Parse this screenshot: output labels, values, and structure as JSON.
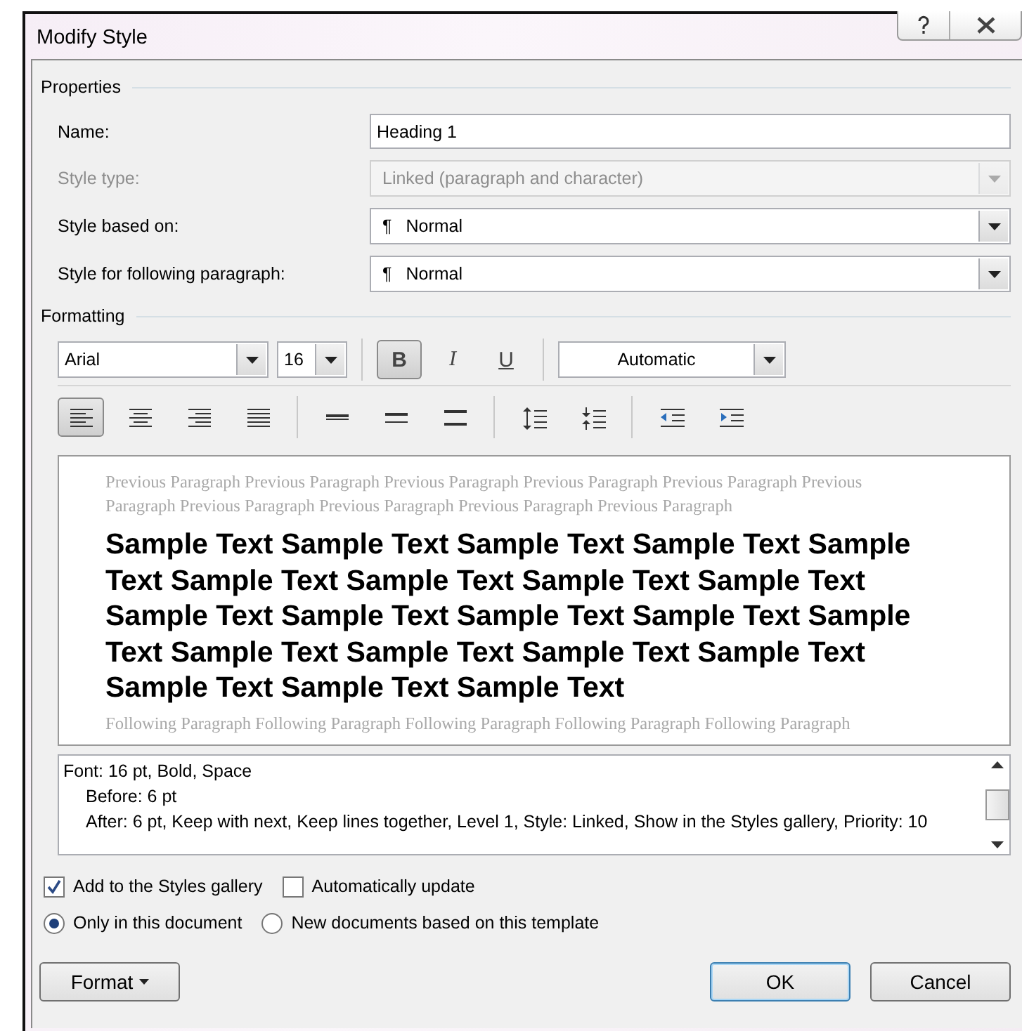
{
  "window": {
    "title": "Modify Style"
  },
  "properties": {
    "heading": "Properties",
    "fields": [
      {
        "label": "Name:",
        "kind": "text",
        "value": "Heading 1",
        "disabled": false
      },
      {
        "label": "Style type:",
        "kind": "combo",
        "value": "Linked (paragraph and character)",
        "disabled": true
      },
      {
        "label": "Style based on:",
        "kind": "combo",
        "symbol": "¶",
        "value": "Normal",
        "disabled": false
      },
      {
        "label": "Style for following paragraph:",
        "kind": "combo",
        "symbol": "¶",
        "value": "Normal",
        "disabled": false
      }
    ]
  },
  "formatting": {
    "heading": "Formatting",
    "font": "Arial",
    "size": "16",
    "color_setting": "Automatic",
    "style_buttons": [
      {
        "label": "B",
        "kind": "bold",
        "on": true
      },
      {
        "label": "I",
        "kind": "italic",
        "on": false
      },
      {
        "label": "U",
        "kind": "underline",
        "on": false
      }
    ],
    "paragraph_groups": [
      [
        {
          "kind": "align-left",
          "selected": true
        },
        {
          "kind": "align-center",
          "selected": false
        },
        {
          "kind": "align-right",
          "selected": false
        },
        {
          "kind": "justify",
          "selected": false
        }
      ],
      [
        {
          "kind": "single-spacing",
          "selected": false
        },
        {
          "kind": "one-half-spacing",
          "selected": false
        },
        {
          "kind": "double-spacing",
          "selected": false
        }
      ],
      [
        {
          "kind": "space-increase",
          "selected": false
        },
        {
          "kind": "space-decrease",
          "selected": false
        }
      ],
      [
        {
          "kind": "indent-decrease",
          "selected": false
        },
        {
          "kind": "indent-increase",
          "selected": false
        }
      ]
    ]
  },
  "preview": {
    "previous": "Previous Paragraph Previous Paragraph Previous Paragraph Previous Paragraph Previous Paragraph Previous Paragraph Previous Paragraph Previous Paragraph Previous Paragraph Previous Paragraph",
    "sample": "Sample Text Sample Text Sample Text Sample Text Sample Text Sample Text Sample Text Sample Text Sample Text Sample Text Sample Text Sample Text Sample Text Sample Text Sample Text Sample Text Sample Text Sample Text Sample Text Sample Text Sample Text",
    "following": "Following Paragraph Following Paragraph Following Paragraph Following Paragraph Following Paragraph"
  },
  "description": [
    {
      "text": "Font: 16 pt, Bold, Space",
      "indent": false
    },
    {
      "text": "Before:  6 pt",
      "indent": true
    },
    {
      "text": "After:  6 pt, Keep with next, Keep lines together, Level 1, Style: Linked, Show in the Styles gallery, Priority: 10",
      "indent": true
    }
  ],
  "checkboxes": [
    {
      "label": "Add to the Styles gallery",
      "checked": true
    },
    {
      "label": "Automatically update",
      "checked": false
    }
  ],
  "radios": [
    {
      "label": "Only in this document",
      "selected": true
    },
    {
      "label": "New documents based on this template",
      "selected": false
    }
  ],
  "buttons": [
    {
      "label": "Format",
      "kind": "menu"
    },
    {
      "label": "OK",
      "kind": "default"
    },
    {
      "label": "Cancel",
      "kind": "normal"
    }
  ]
}
